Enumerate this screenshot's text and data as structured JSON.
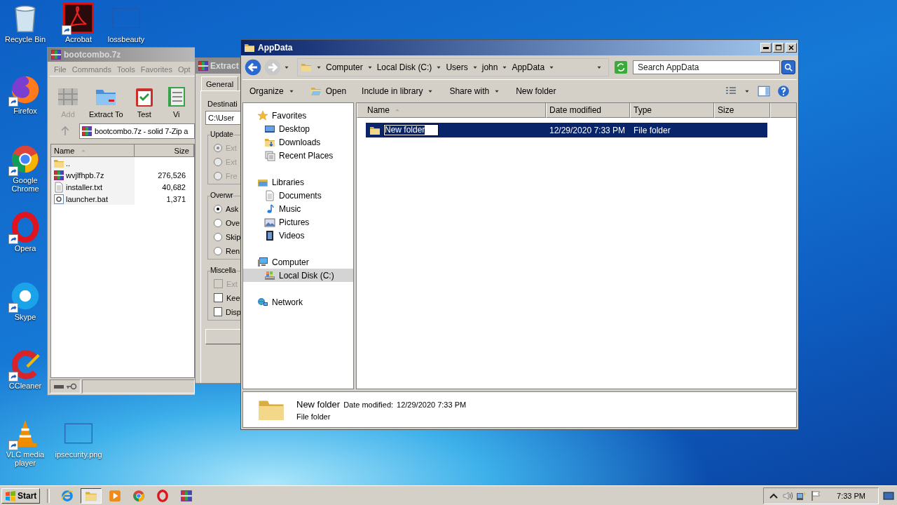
{
  "desktop": {
    "icons": [
      {
        "label": "Recycle Bin",
        "kind": "recycle",
        "shortcut": false
      },
      {
        "label": "Acrobat",
        "kind": "acrobat",
        "shortcut": true
      },
      {
        "label": "lossbeauty",
        "kind": "blank",
        "shortcut": false
      },
      {
        "label": "Firefox",
        "kind": "firefox",
        "shortcut": true
      },
      {
        "label": "Google Chrome",
        "kind": "chrome",
        "shortcut": true
      },
      {
        "label": "Opera",
        "kind": "opera",
        "shortcut": true
      },
      {
        "label": "Skype",
        "kind": "skype",
        "shortcut": true
      },
      {
        "label": "CCleaner",
        "kind": "ccleaner",
        "shortcut": true
      },
      {
        "label": "VLC media player",
        "kind": "vlc",
        "shortcut": true
      },
      {
        "label": "ipsecurity.png",
        "kind": "blank",
        "shortcut": false
      }
    ]
  },
  "archive_window": {
    "title": "bootcombo.7z",
    "menu": [
      "File",
      "Commands",
      "Tools",
      "Favorites",
      "Opt"
    ],
    "toolbar": [
      {
        "label": "Add",
        "kind": "add",
        "disabled": true
      },
      {
        "label": "Extract To",
        "kind": "extract",
        "disabled": false
      },
      {
        "label": "Test",
        "kind": "test",
        "disabled": false
      },
      {
        "label": "Vi",
        "kind": "view",
        "disabled": false
      }
    ],
    "path": "bootcombo.7z - solid 7-Zip a",
    "columns": [
      {
        "label": "Name",
        "sorted": true
      },
      {
        "label": "Size",
        "sorted": false
      }
    ],
    "rows": [
      {
        "name": "..",
        "kind": "up"
      },
      {
        "name": "wvjlfhpb.7z",
        "kind": "archive",
        "size": "276,526"
      },
      {
        "name": "installer.txt",
        "kind": "text",
        "size": "40,682"
      },
      {
        "name": "launcher.bat",
        "kind": "batch",
        "size": "1,371"
      }
    ]
  },
  "extract_dialog": {
    "title": "Extract",
    "tabs": [
      {
        "label": "General",
        "selected": true
      }
    ],
    "destination_label": "Destinati",
    "destination": "C:\\User",
    "groups": [
      {
        "title": "Update",
        "options": [
          {
            "kind": "radio",
            "label": "Ext",
            "checked": true,
            "disabled": true
          },
          {
            "kind": "radio",
            "label": "Ext",
            "checked": false,
            "disabled": true
          },
          {
            "kind": "radio",
            "label": "Fre",
            "checked": false,
            "disabled": true
          }
        ]
      },
      {
        "title": "Overwr",
        "options": [
          {
            "kind": "radio",
            "label": "Ask",
            "checked": true,
            "disabled": false
          },
          {
            "kind": "radio",
            "label": "Ove",
            "checked": false,
            "disabled": false
          },
          {
            "kind": "radio",
            "label": "Skip",
            "checked": false,
            "disabled": false
          },
          {
            "kind": "radio",
            "label": "Ren",
            "checked": false,
            "disabled": false
          }
        ]
      },
      {
        "title": "Miscella",
        "options": [
          {
            "kind": "checkbox",
            "label": "Ext",
            "checked": false,
            "disabled": true
          },
          {
            "kind": "checkbox",
            "label": "Kee",
            "checked": false,
            "disabled": false
          },
          {
            "kind": "checkbox",
            "label": "Disp",
            "checked": false,
            "disabled": false
          }
        ]
      }
    ]
  },
  "explorer": {
    "title": "AppData",
    "breadcrumbs": [
      "Computer",
      "Local Disk (C:)",
      "Users",
      "john",
      "AppData"
    ],
    "search": {
      "placeholder": "Search AppData"
    },
    "toolbar": [
      {
        "label": "Organize",
        "kind": "menu",
        "dropdown": true
      },
      {
        "label": "Open",
        "kind": "open",
        "dropdown": false
      },
      {
        "label": "Include in library",
        "kind": "menu",
        "dropdown": true
      },
      {
        "label": "Share with",
        "kind": "menu",
        "dropdown": true
      },
      {
        "label": "New folder",
        "kind": "menu",
        "dropdown": false
      }
    ],
    "nav": [
      {
        "label": "Favorites",
        "kind": "star",
        "selected": false,
        "children": [
          {
            "label": "Desktop",
            "kind": "desktop",
            "selected": false
          },
          {
            "label": "Downloads",
            "kind": "downloads",
            "selected": false
          },
          {
            "label": "Recent Places",
            "kind": "recent",
            "selected": false
          }
        ]
      },
      {
        "label": "Libraries",
        "kind": "library",
        "selected": false,
        "children": [
          {
            "label": "Documents",
            "kind": "text",
            "selected": false
          },
          {
            "label": "Music",
            "kind": "music",
            "selected": false
          },
          {
            "label": "Pictures",
            "kind": "pictures",
            "selected": false
          },
          {
            "label": "Videos",
            "kind": "videos",
            "selected": false
          }
        ]
      },
      {
        "label": "Computer",
        "kind": "computer",
        "selected": false,
        "children": [
          {
            "label": "Local Disk (C:)",
            "kind": "disk",
            "selected": true
          }
        ]
      },
      {
        "label": "Network",
        "kind": "network",
        "selected": false
      }
    ],
    "columns": [
      {
        "label": "Name",
        "sorted": true
      },
      {
        "label": "Date modified",
        "sorted": false
      },
      {
        "label": "Type",
        "sorted": false
      },
      {
        "label": "Size",
        "sorted": false
      }
    ],
    "rows": [
      {
        "name": "New folder",
        "date": "12/29/2020 7:33 PM",
        "type": "File folder",
        "selected": true,
        "renaming": true
      }
    ],
    "details": {
      "name": "New folder",
      "date_label": "Date modified:",
      "date": "12/29/2020 7:33 PM",
      "type": "File folder"
    }
  },
  "taskbar": {
    "start": "Start",
    "apps": [
      {
        "kind": "ie",
        "active": false
      },
      {
        "kind": "folder",
        "active": true
      },
      {
        "kind": "media",
        "active": false
      },
      {
        "kind": "chrome",
        "active": false
      },
      {
        "kind": "opera",
        "active": false
      },
      {
        "kind": "archive",
        "active": false
      }
    ],
    "clock": "7:33 PM"
  }
}
